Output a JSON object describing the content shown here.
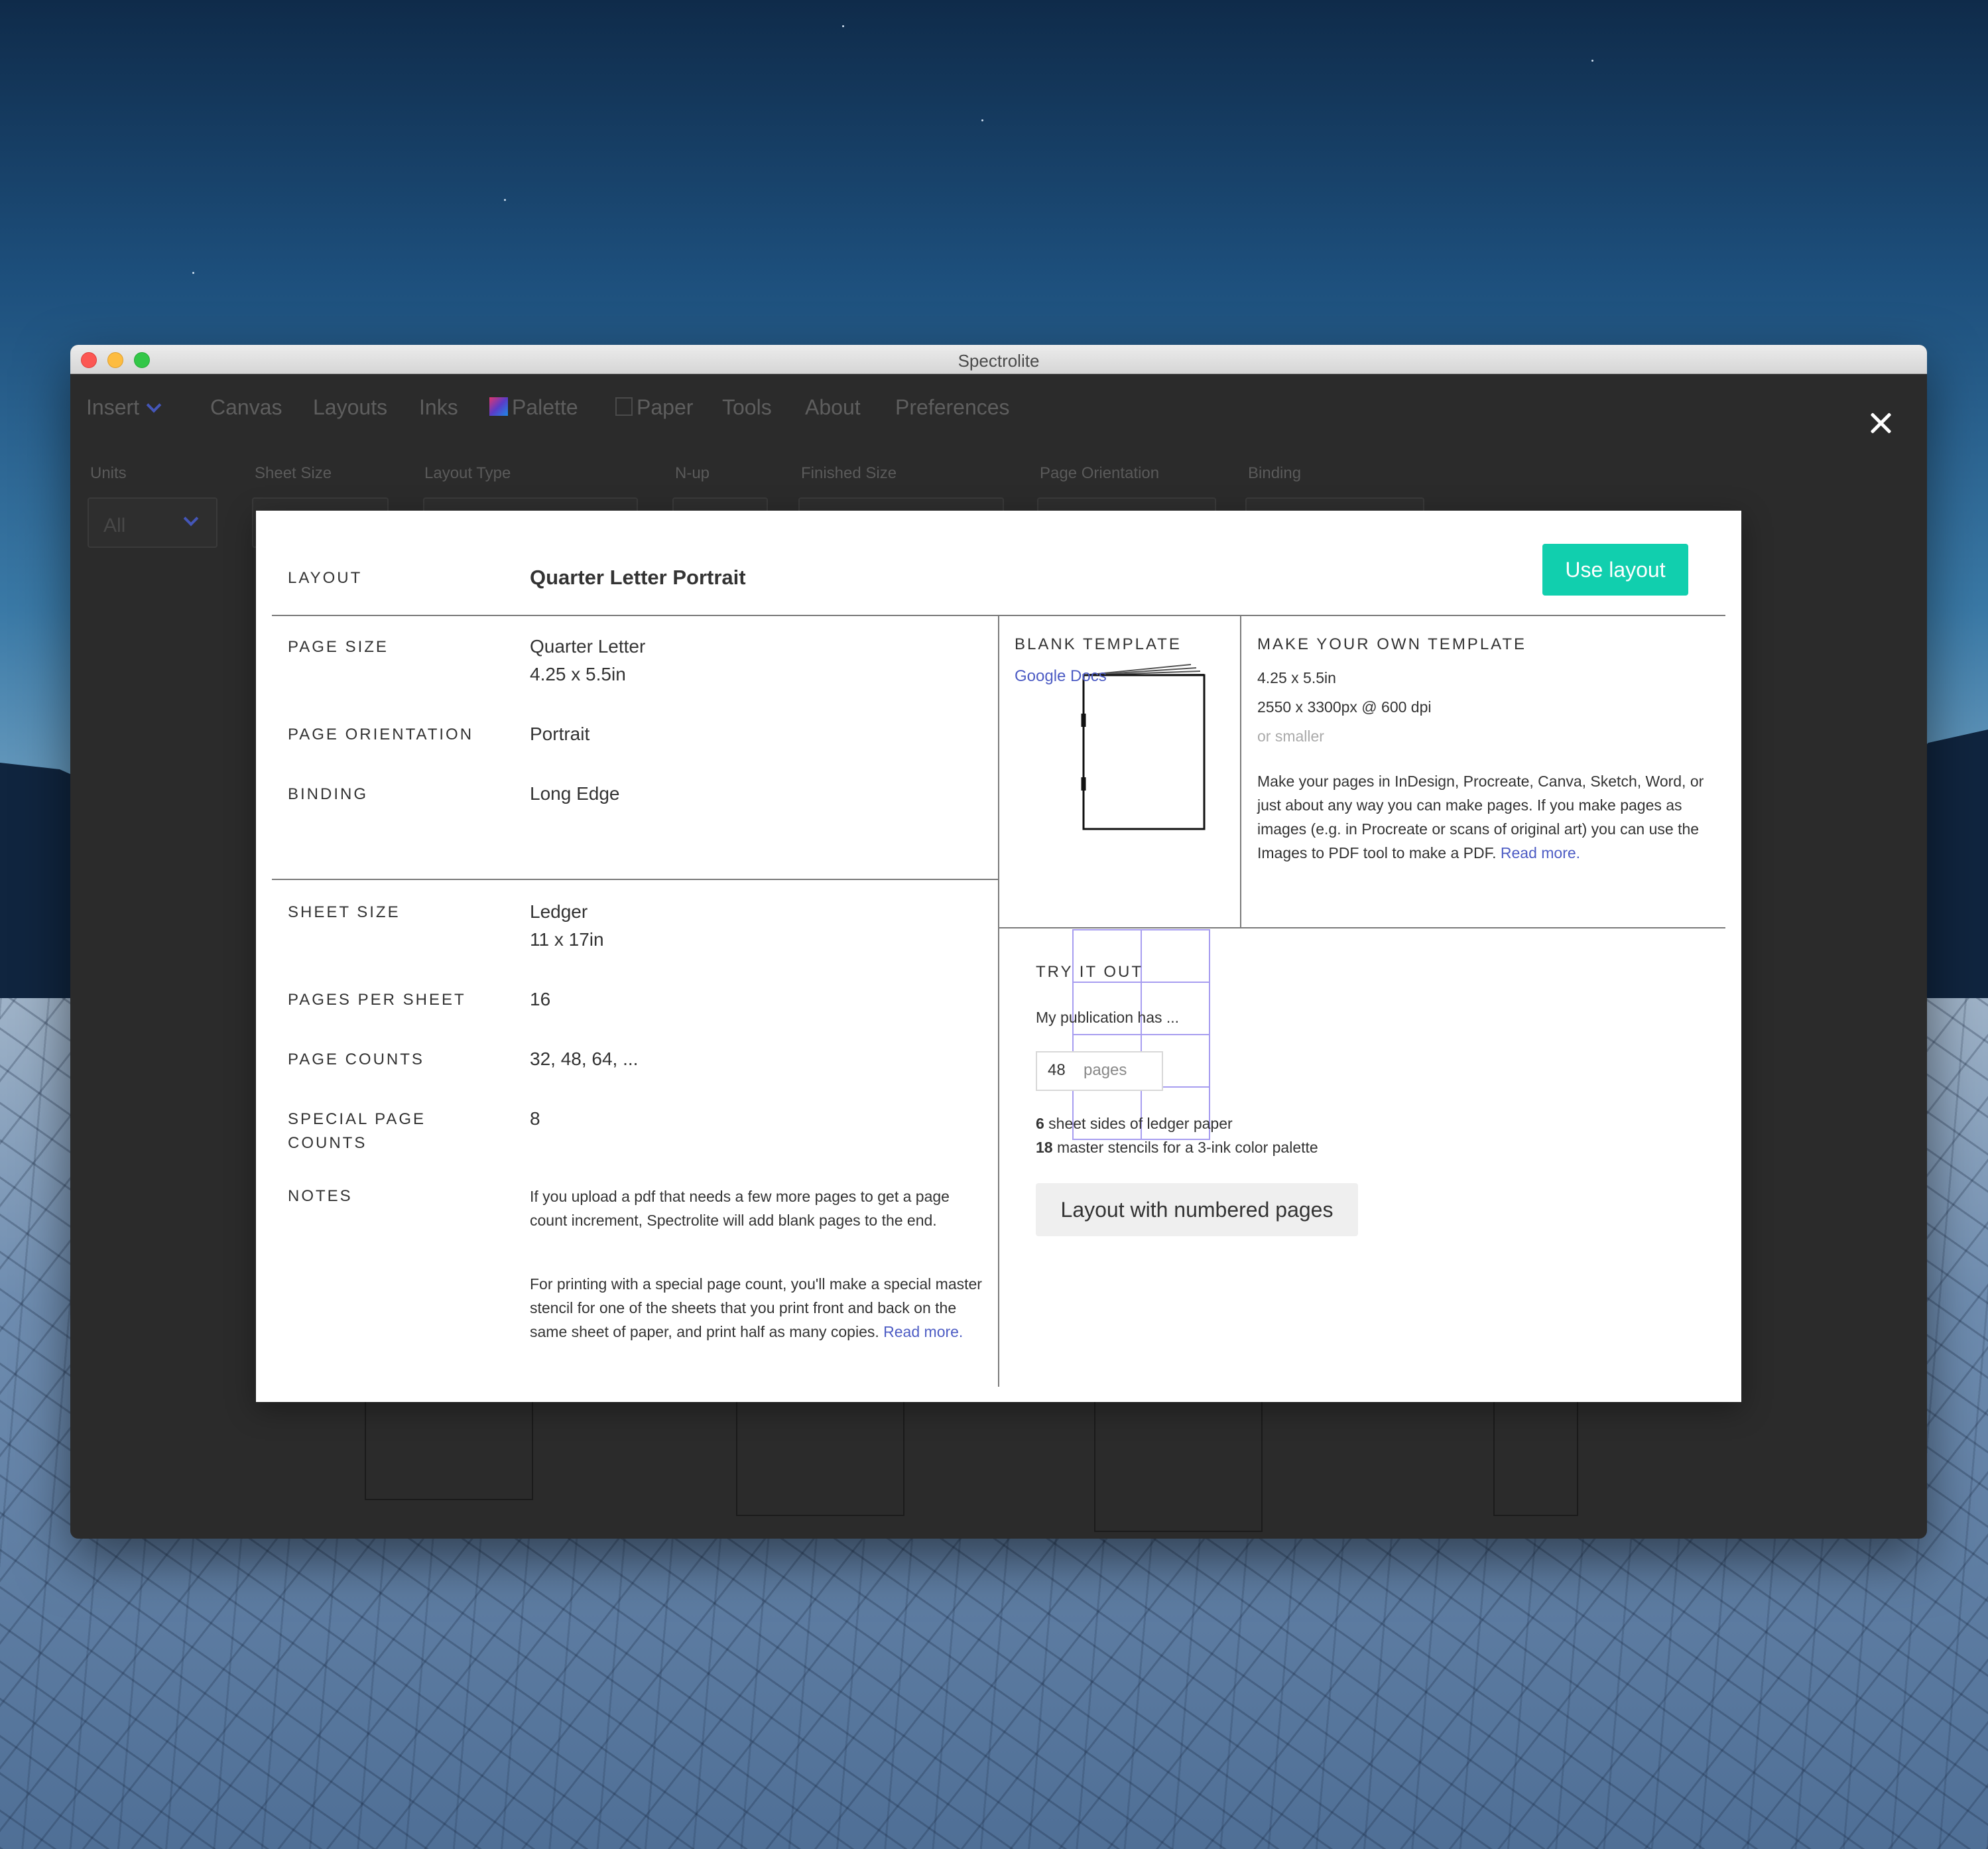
{
  "window": {
    "title": "Spectrolite"
  },
  "menu": {
    "insert": "Insert",
    "canvas": "Canvas",
    "layouts": "Layouts",
    "inks": "Inks",
    "palette": "Palette",
    "paper": "Paper",
    "tools": "Tools",
    "about": "About",
    "preferences": "Preferences"
  },
  "filters": {
    "units_label": "Units",
    "units_value": "All",
    "sheet_size_label": "Sheet Size",
    "layout_type_label": "Layout Type",
    "nup_label": "N-up",
    "finished_size_label": "Finished Size",
    "page_orientation_label": "Page Orientation",
    "binding_label": "Binding"
  },
  "modal": {
    "layout_label": "LAYOUT",
    "layout_name": "Quarter Letter Portrait",
    "use_layout_label": "Use layout",
    "page_size_label": "PAGE SIZE",
    "page_size_name": "Quarter Letter",
    "page_size_dims": "4.25 x 5.5in",
    "page_orientation_label": "PAGE ORIENTATION",
    "page_orientation_value": "Portrait",
    "binding_label": "BINDING",
    "binding_value": "Long Edge",
    "sheet_size_label": "SHEET SIZE",
    "sheet_size_name": "Ledger",
    "sheet_size_dims": "11 x 17in",
    "pages_per_sheet_label": "PAGES PER SHEET",
    "pages_per_sheet_value": "16",
    "page_counts_label": "PAGE COUNTS",
    "page_counts_value": "32, 48, 64, ...",
    "special_label_1": "SPECIAL PAGE",
    "special_label_2": "COUNTS",
    "special_value": "8",
    "notes_label": "NOTES",
    "notes_1": "If you upload a pdf that needs a few more pages to get a page count increment, Spectrolite will add blank pages to the end.",
    "notes_2": "For printing with a special page count, you'll make a special master stencil for one of the sheets that you print front and back on the same sheet of paper, and print half as many copies.",
    "notes_read_more": "Read more.",
    "blank_template_label": "BLANK TEMPLATE",
    "google_docs_link": "Google Docs",
    "own_template_label": "MAKE YOUR OWN TEMPLATE",
    "own_dims": "4.25 x 5.5in",
    "own_px": "2550 x 3300px @ 600 dpi",
    "own_smaller": "or smaller",
    "own_desc": "Make your pages in InDesign, Procreate, Canva, Sketch, Word, or just about any way you can make pages. If you make pages as images (e.g. in Procreate or scans of original art) you can use the Images to PDF tool to make a PDF.",
    "own_read_more": "Read more.",
    "try_label": "TRY IT OUT",
    "publication_has": "My publication has ...",
    "pages_value": "48",
    "pages_unit": "pages",
    "result_1_num": "6",
    "result_1_text": " sheet sides of ledger paper",
    "result_2_num": "18",
    "result_2_text": " master stencils for a 3-ink color palette",
    "numbered_button": "Layout with numbered pages"
  },
  "colors": {
    "accent": "#11cfae",
    "link": "#4d5cc4",
    "grid": "#a79df0"
  }
}
